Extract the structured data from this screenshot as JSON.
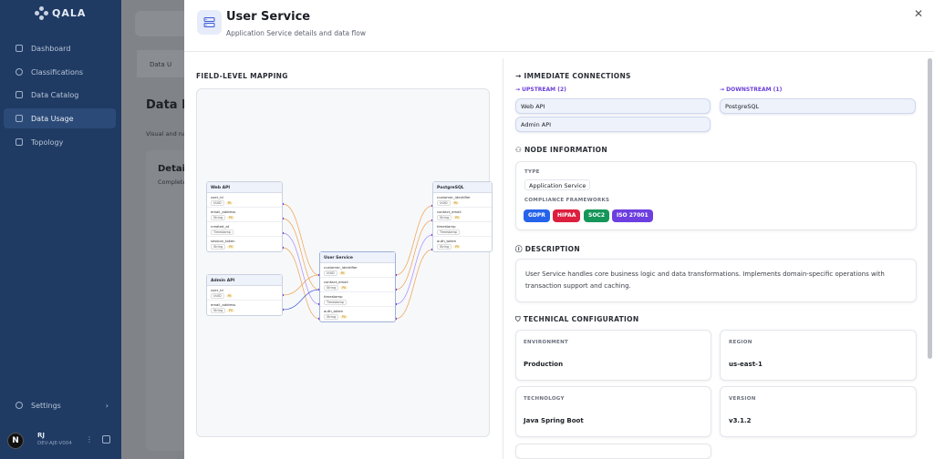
{
  "app": {
    "brand": "QALA"
  },
  "sidebar": {
    "items": [
      {
        "label": "Dashboard",
        "icon": "grid-icon"
      },
      {
        "label": "Classifications",
        "icon": "tag-icon"
      },
      {
        "label": "Data Catalog",
        "icon": "layers-icon"
      },
      {
        "label": "Data Usage",
        "icon": "database-icon",
        "active": true
      },
      {
        "label": "Topology",
        "icon": "network-icon"
      }
    ],
    "settings": "Settings",
    "user": {
      "initial": "N",
      "name": "RJ",
      "id": "DEV-AJE-V004"
    }
  },
  "background": {
    "tab": "Data U",
    "title": "Data Li",
    "subtitle": "Visual and na",
    "card_title": "Detail",
    "card_sub": "Complete"
  },
  "drawer": {
    "title": "User Service",
    "subtitle": "Application Service details and data flow",
    "mapping_label": "FIELD-LEVEL MAPPING",
    "mapping": {
      "web_api": {
        "title": "Web API",
        "fields": [
          {
            "name": "user_id",
            "type": "UUID",
            "pii": "PII"
          },
          {
            "name": "email_address",
            "type": "String",
            "pii": "PII"
          },
          {
            "name": "created_at",
            "type": "Timestamp",
            "pii": ""
          },
          {
            "name": "session_token",
            "type": "String",
            "pii": "PII"
          }
        ]
      },
      "admin_api": {
        "title": "Admin API",
        "fields": [
          {
            "name": "user_id",
            "type": "UUID",
            "pii": "PII"
          },
          {
            "name": "email_address",
            "type": "String",
            "pii": "PII"
          }
        ]
      },
      "user_service": {
        "title": "User Service",
        "fields": [
          {
            "name": "customer_identifier",
            "type": "UUID",
            "pii": "PII"
          },
          {
            "name": "contact_email",
            "type": "String",
            "pii": "PII"
          },
          {
            "name": "timestamp",
            "type": "Timestamp",
            "pii": ""
          },
          {
            "name": "auth_token",
            "type": "String",
            "pii": "PII"
          }
        ]
      },
      "postgresql": {
        "title": "PostgreSQL",
        "fields": [
          {
            "name": "customer_identifier",
            "type": "UUID",
            "pii": "PII"
          },
          {
            "name": "contact_email",
            "type": "String",
            "pii": "PII"
          },
          {
            "name": "timestamp",
            "type": "Timestamp",
            "pii": ""
          },
          {
            "name": "auth_token",
            "type": "String",
            "pii": "PII"
          }
        ]
      }
    },
    "connections": {
      "label": "IMMEDIATE CONNECTIONS",
      "upstream_label": "UPSTREAM (2)",
      "downstream_label": "DOWNSTREAM (1)",
      "upstream": [
        "Web API",
        "Admin API"
      ],
      "downstream": [
        "PostgreSQL"
      ]
    },
    "node_info": {
      "label": "NODE INFORMATION",
      "type_label": "TYPE",
      "type_value": "Application Service",
      "frameworks_label": "COMPLIANCE FRAMEWORKS",
      "frameworks": [
        {
          "name": "GDPR",
          "color": "#2563eb"
        },
        {
          "name": "HIPAA",
          "color": "#dc1f3f"
        },
        {
          "name": "SOC2",
          "color": "#15965a"
        },
        {
          "name": "ISO 27001",
          "color": "#6d3fe0"
        }
      ]
    },
    "description": {
      "label": "DESCRIPTION",
      "text": "User Service handles core business logic and data transformations. Implements domain-specific operations with transaction support and caching."
    },
    "tech": {
      "label": "TECHNICAL CONFIGURATION",
      "environment_label": "ENVIRONMENT",
      "environment": "Production",
      "region_label": "REGION",
      "region": "us-east-1",
      "technology_label": "TECHNOLOGY",
      "technology": "Java Spring Boot",
      "version_label": "VERSION",
      "version": "v3.1.2"
    }
  }
}
